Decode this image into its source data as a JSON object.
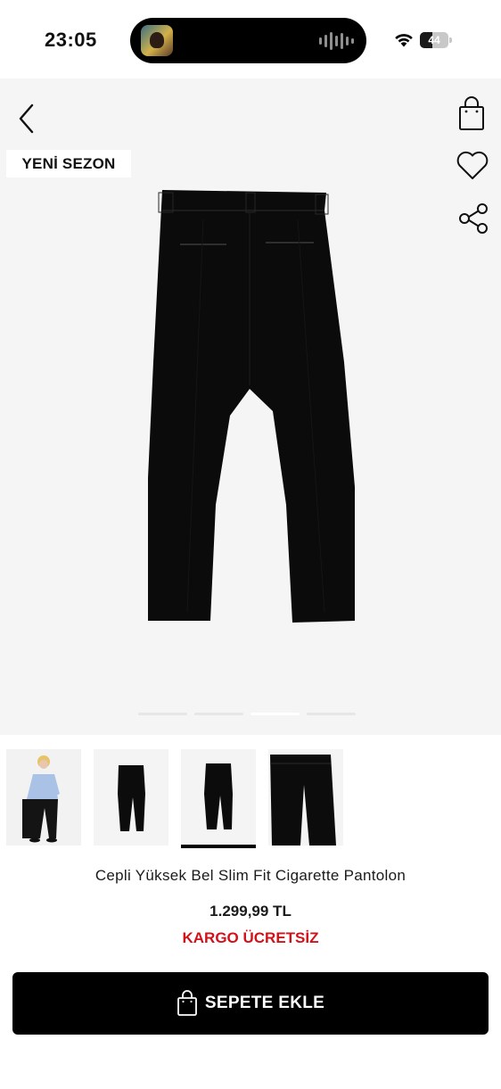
{
  "status_bar": {
    "time": "23:05",
    "battery_level": "44",
    "battery_fraction": 0.44
  },
  "product": {
    "badge": "YENİ SEZON",
    "title": "Cepli Yüksek Bel Slim Fit Cigarette Pantolon",
    "price": "1.299,99 TL",
    "shipping": "KARGO ÜCRETSİZ"
  },
  "gallery": {
    "image_count": 4,
    "active_index": 2,
    "thumbnails": [
      "model-photo",
      "pants-front-photo",
      "pants-back-photo",
      "pants-detail-photo"
    ]
  },
  "actions": {
    "add_to_cart": "SEPETE EKLE"
  },
  "icons": {
    "back": "chevron-left-icon",
    "bag": "shopping-bag-icon",
    "favorite": "heart-icon",
    "share": "share-icon"
  },
  "colors": {
    "accent_red": "#d0121b",
    "button_bg": "#000000",
    "hero_bg": "#f5f5f5"
  }
}
